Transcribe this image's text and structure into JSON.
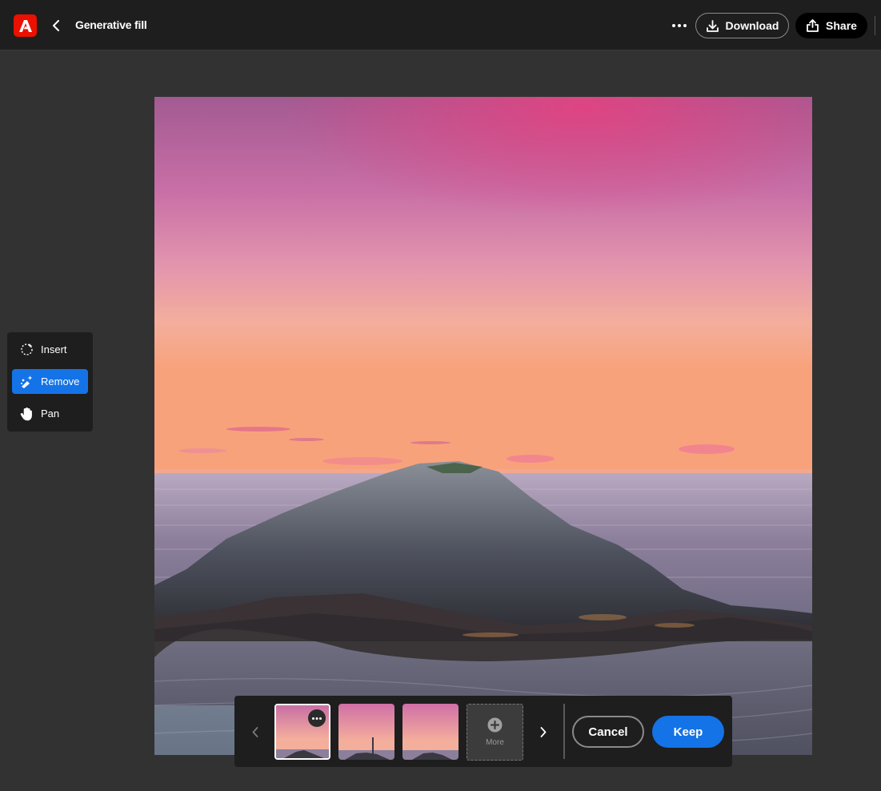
{
  "header": {
    "app_logo_icon": "adobe-express-logo",
    "title": "Generative fill",
    "download_label": "Download",
    "share_label": "Share"
  },
  "tools": [
    {
      "label": "Insert",
      "icon": "sparkle-brush-icon",
      "active": false
    },
    {
      "label": "Remove",
      "icon": "eraser-brush-icon",
      "active": true
    },
    {
      "label": "Pan",
      "icon": "hand-icon",
      "active": false
    }
  ],
  "variations": {
    "more_label": "More",
    "cancel_label": "Cancel",
    "keep_label": "Keep",
    "selected_index": 0
  },
  "colors": {
    "accent": "#1473e6",
    "brand": "#eb1000",
    "topbar": "#1e1e1e",
    "workspace": "#323232"
  }
}
